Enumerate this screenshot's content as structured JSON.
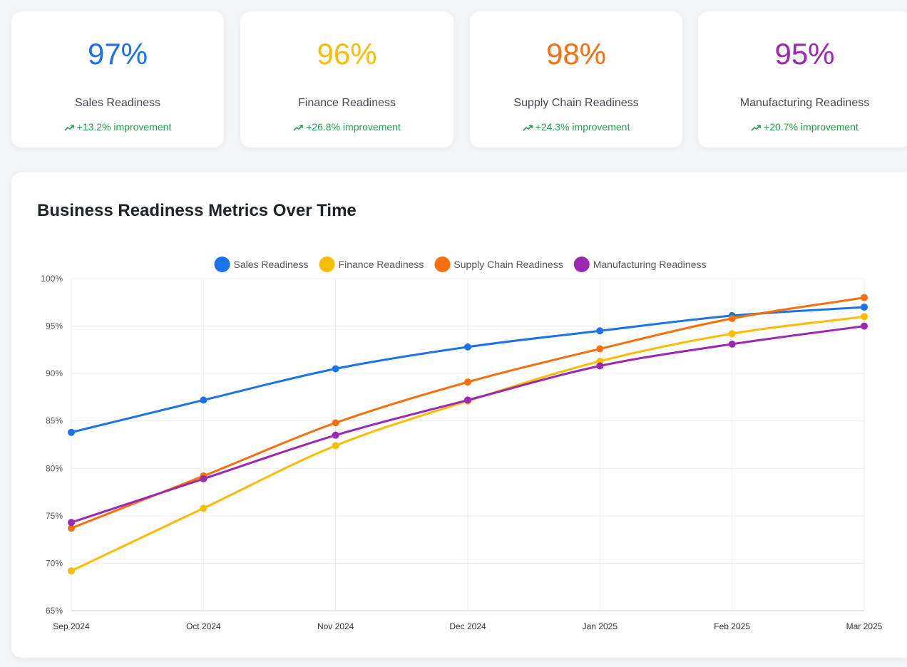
{
  "kpis": [
    {
      "value": "97%",
      "label": "Sales Readiness",
      "trend": "+13.2% improvement",
      "color": "#1a73e8"
    },
    {
      "value": "96%",
      "label": "Finance Readiness",
      "trend": "+26.8% improvement",
      "color": "#fbbc04"
    },
    {
      "value": "98%",
      "label": "Supply Chain Readiness",
      "trend": "+24.3% improvement",
      "color": "#f96f0e"
    },
    {
      "value": "95%",
      "label": "Manufacturing Readiness",
      "trend": "+20.7% improvement",
      "color": "#9c27b0"
    }
  ],
  "trend_icon": "trending-up-icon",
  "chart_data": {
    "type": "line",
    "title": "Business Readiness Metrics Over Time",
    "xlabel": "",
    "ylabel": "",
    "categories": [
      "Sep 2024",
      "Oct 2024",
      "Nov 2024",
      "Dec 2024",
      "Jan 2025",
      "Feb 2025",
      "Mar 2025"
    ],
    "ylim": [
      65,
      100
    ],
    "yticks": [
      "65%",
      "70%",
      "75%",
      "80%",
      "85%",
      "90%",
      "95%",
      "100%"
    ],
    "grid": true,
    "legend_position": "top",
    "series": [
      {
        "name": "Sales Readiness",
        "color": "#1a73e8",
        "values": [
          83.8,
          87.2,
          90.5,
          92.8,
          94.5,
          96.1,
          97.0
        ]
      },
      {
        "name": "Finance Readiness",
        "color": "#fbbc04",
        "values": [
          69.2,
          75.8,
          82.4,
          87.1,
          91.3,
          94.2,
          96.0
        ]
      },
      {
        "name": "Supply Chain Readiness",
        "color": "#f96f0e",
        "values": [
          73.7,
          79.2,
          84.8,
          89.1,
          92.6,
          95.8,
          98.0
        ]
      },
      {
        "name": "Manufacturing Readiness",
        "color": "#9c27b0",
        "values": [
          74.3,
          78.9,
          83.5,
          87.2,
          90.8,
          93.1,
          95.0
        ]
      }
    ]
  }
}
